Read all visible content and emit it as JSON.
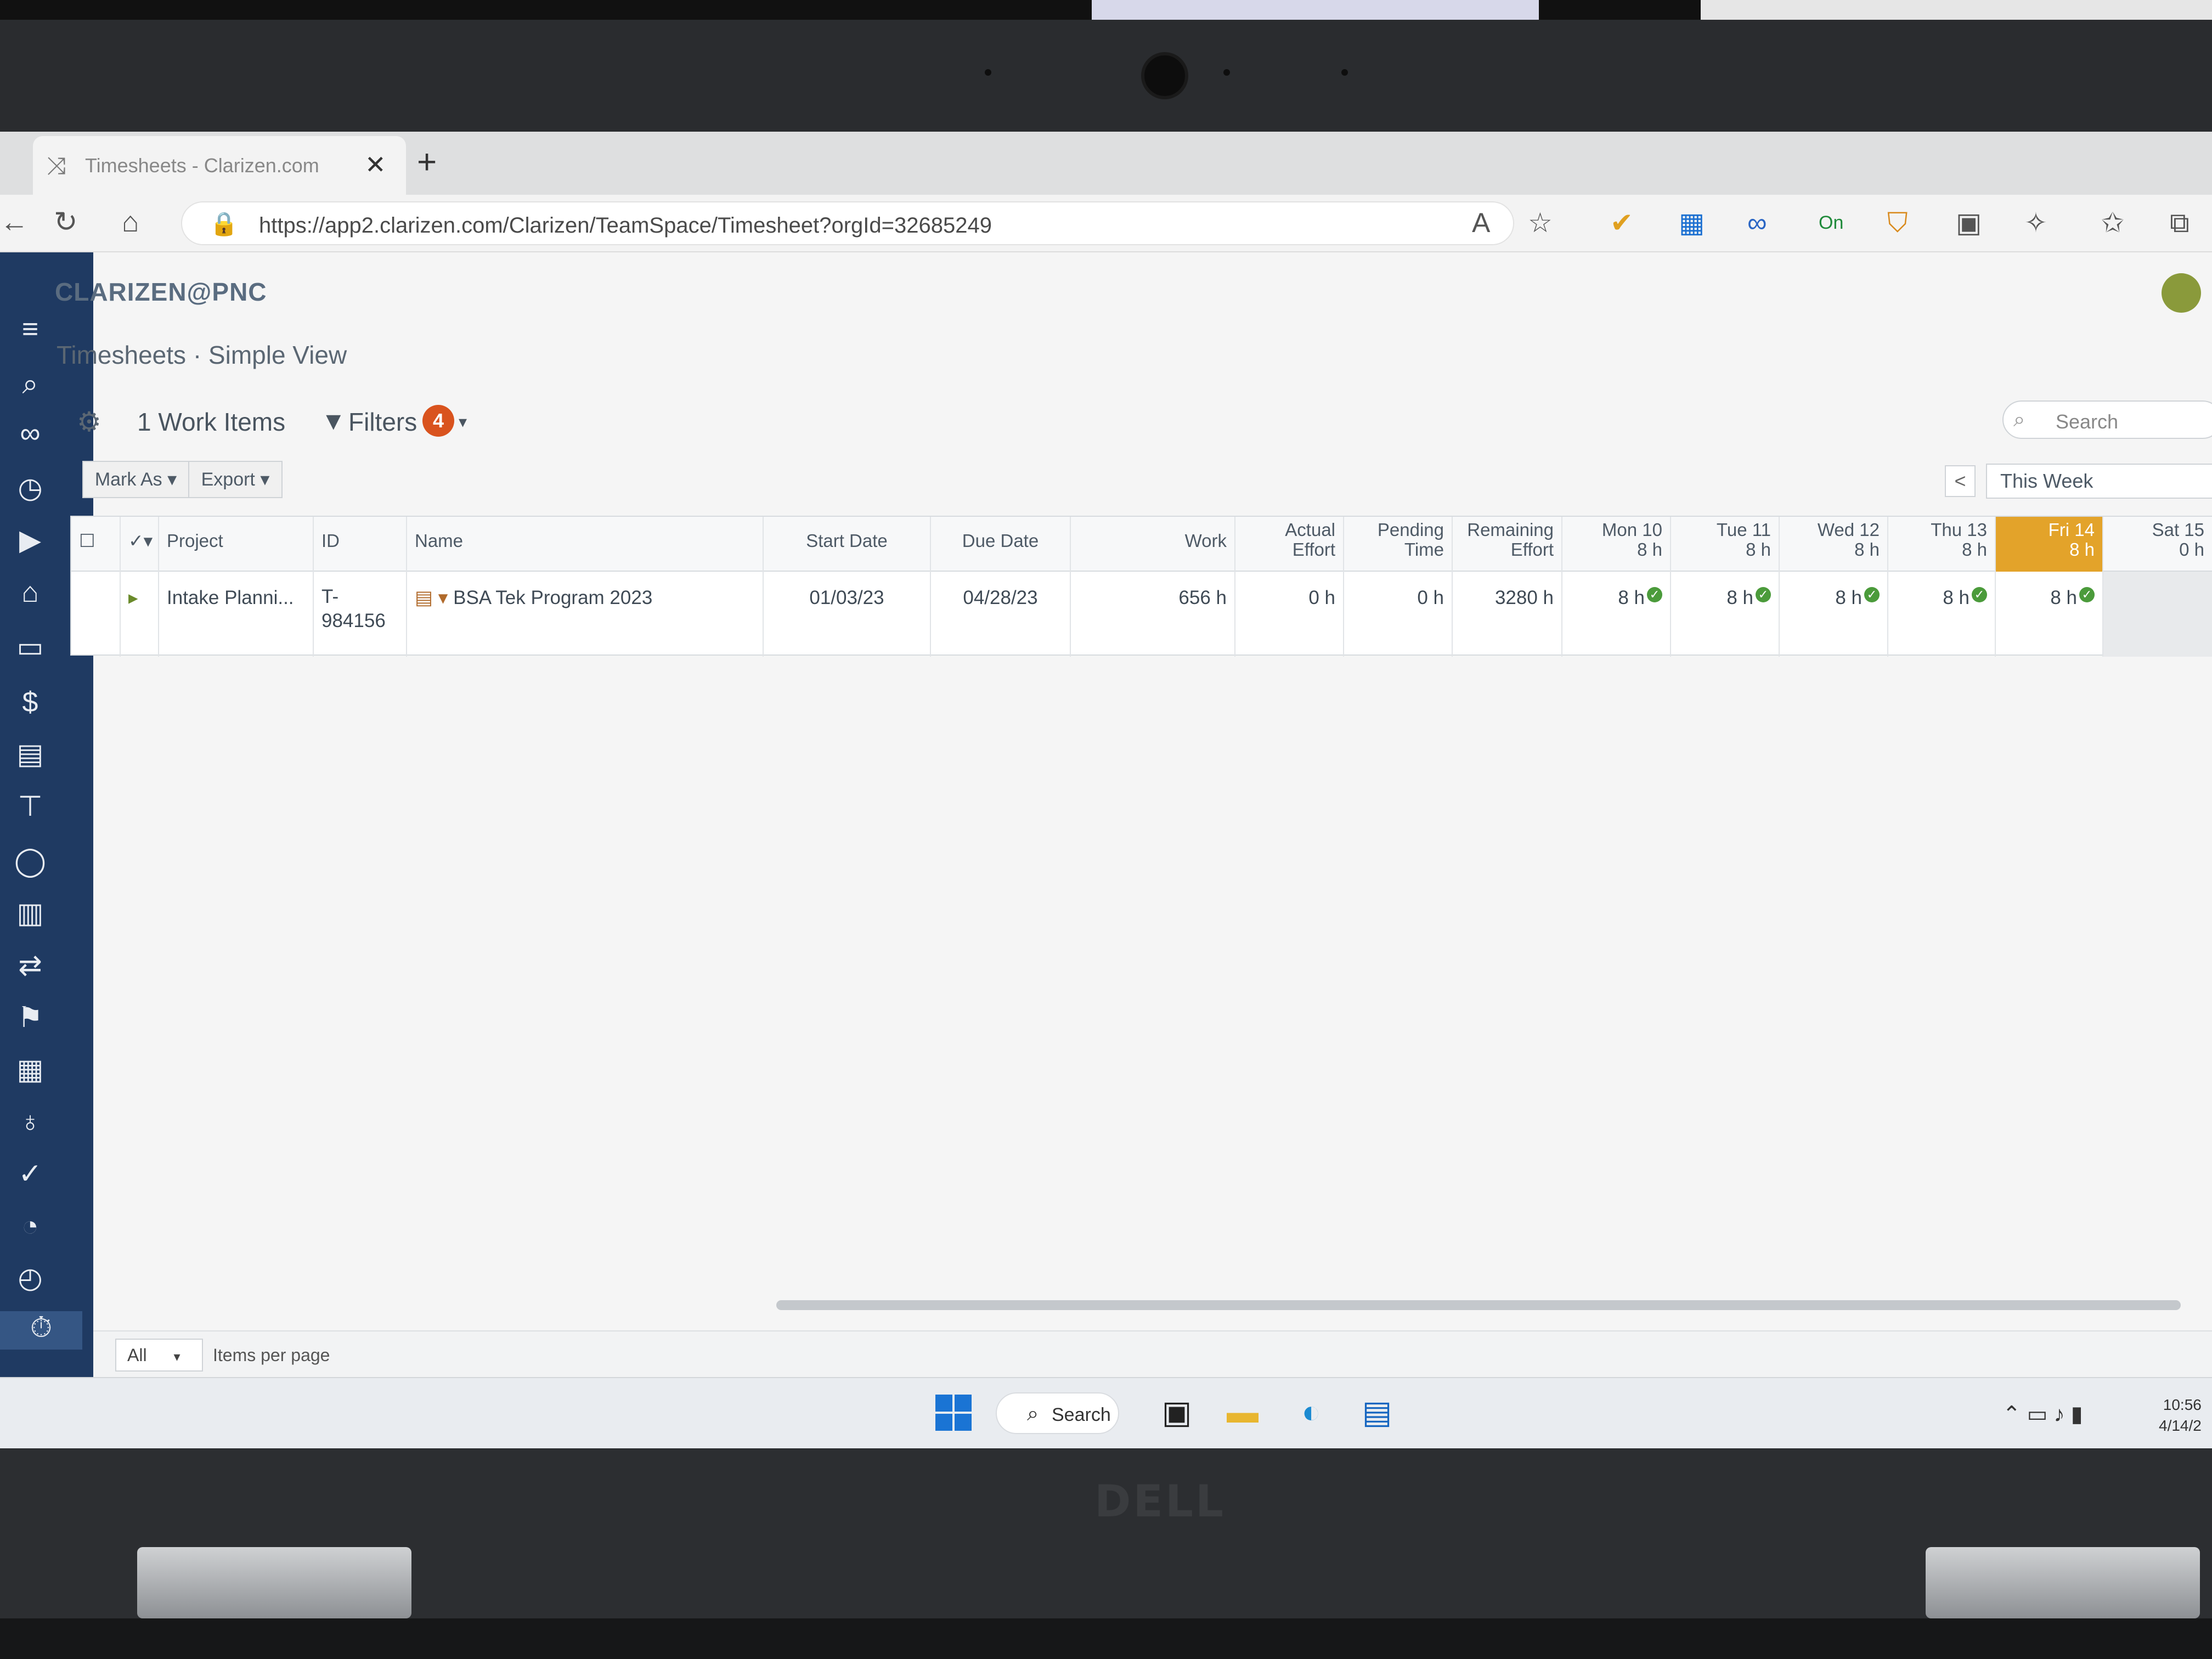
{
  "browser": {
    "tab_title": "Timesheets - Clarizen.com",
    "url": "https://app2.clarizen.com/Clarizen/TeamSpace/Timesheet?orgId=32685249",
    "new_tab_symbol": "+",
    "close_symbol": "✕",
    "extension_on_label": "On"
  },
  "app": {
    "logo": "CLARIZEN@PNC",
    "page_title": "Timesheets · Simple View",
    "work_items": "1 Work Items",
    "filters_label": "Filters",
    "filters_count": "4",
    "search_placeholder": "Search",
    "mark_as": "Mark As",
    "export": "Export",
    "week_selector": "This Week",
    "prev_week_symbol": "<"
  },
  "grid": {
    "columns": {
      "project": "Project",
      "id": "ID",
      "name": "Name",
      "start_date": "Start Date",
      "due_date": "Due Date",
      "work": "Work",
      "actual_effort_1": "Actual",
      "actual_effort_2": "Effort",
      "pending_time_1": "Pending",
      "pending_time_2": "Time",
      "remaining_effort_1": "Remaining",
      "remaining_effort_2": "Effort",
      "mon": "Mon 10",
      "mon_sub": "8 h",
      "tue": "Tue 11",
      "tue_sub": "8 h",
      "wed": "Wed 12",
      "wed_sub": "8 h",
      "thu": "Thu 13",
      "thu_sub": "8 h",
      "fri": "Fri 14",
      "fri_sub": "8 h",
      "sat": "Sat 15",
      "sat_sub": "0 h"
    },
    "row": {
      "project": "Intake Planni...",
      "id_1": "T-",
      "id_2": "984156",
      "name": "BSA Tek Program 2023",
      "start_date": "01/03/23",
      "due_date": "04/28/23",
      "work": "656 h",
      "actual_effort": "0 h",
      "pending_time": "0 h",
      "remaining_effort": "3280 h",
      "mon": "8 h",
      "tue": "8 h",
      "wed": "8 h",
      "thu": "8 h",
      "fri": "8 h",
      "sat": ""
    }
  },
  "footer": {
    "per_page_value": "All",
    "per_page_label": "Items per page"
  },
  "taskbar": {
    "search_label": "Search",
    "time": "10:56",
    "date": "4/14/2"
  },
  "device": {
    "brand": "DELL"
  },
  "colors": {
    "rail": "#1f3a62",
    "today_header": "#e3a32a",
    "badge": "#d9531e",
    "check": "#4b9b3b"
  }
}
